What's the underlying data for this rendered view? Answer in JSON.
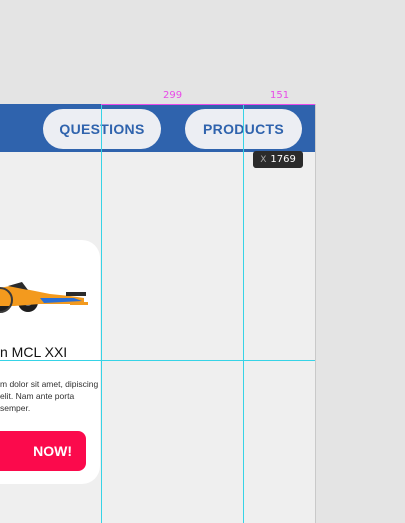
{
  "navbar": {
    "questions_label": "QUESTIONS",
    "products_label": "PRODUCTS",
    "color": "#2f63ad"
  },
  "product_card": {
    "title": "n MCL XXI",
    "description": "m dolor sit amet, dipiscing elit. Nam ante porta semper.",
    "buy_label": "NOW!",
    "buy_color": "#fb0a4c"
  },
  "editor_overlay": {
    "measure_left": "299",
    "measure_right": "151",
    "dimension_prefix": "X",
    "dimension_value": "1769"
  }
}
